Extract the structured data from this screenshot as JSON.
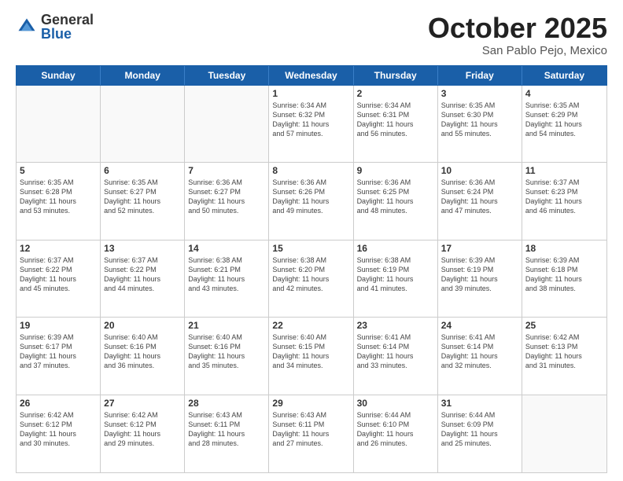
{
  "header": {
    "logo_general": "General",
    "logo_blue": "Blue",
    "month_title": "October 2025",
    "location": "San Pablo Pejo, Mexico"
  },
  "weekdays": [
    "Sunday",
    "Monday",
    "Tuesday",
    "Wednesday",
    "Thursday",
    "Friday",
    "Saturday"
  ],
  "weeks": [
    [
      {
        "day": "",
        "info": ""
      },
      {
        "day": "",
        "info": ""
      },
      {
        "day": "",
        "info": ""
      },
      {
        "day": "1",
        "info": "Sunrise: 6:34 AM\nSunset: 6:32 PM\nDaylight: 11 hours\nand 57 minutes."
      },
      {
        "day": "2",
        "info": "Sunrise: 6:34 AM\nSunset: 6:31 PM\nDaylight: 11 hours\nand 56 minutes."
      },
      {
        "day": "3",
        "info": "Sunrise: 6:35 AM\nSunset: 6:30 PM\nDaylight: 11 hours\nand 55 minutes."
      },
      {
        "day": "4",
        "info": "Sunrise: 6:35 AM\nSunset: 6:29 PM\nDaylight: 11 hours\nand 54 minutes."
      }
    ],
    [
      {
        "day": "5",
        "info": "Sunrise: 6:35 AM\nSunset: 6:28 PM\nDaylight: 11 hours\nand 53 minutes."
      },
      {
        "day": "6",
        "info": "Sunrise: 6:35 AM\nSunset: 6:27 PM\nDaylight: 11 hours\nand 52 minutes."
      },
      {
        "day": "7",
        "info": "Sunrise: 6:36 AM\nSunset: 6:27 PM\nDaylight: 11 hours\nand 50 minutes."
      },
      {
        "day": "8",
        "info": "Sunrise: 6:36 AM\nSunset: 6:26 PM\nDaylight: 11 hours\nand 49 minutes."
      },
      {
        "day": "9",
        "info": "Sunrise: 6:36 AM\nSunset: 6:25 PM\nDaylight: 11 hours\nand 48 minutes."
      },
      {
        "day": "10",
        "info": "Sunrise: 6:36 AM\nSunset: 6:24 PM\nDaylight: 11 hours\nand 47 minutes."
      },
      {
        "day": "11",
        "info": "Sunrise: 6:37 AM\nSunset: 6:23 PM\nDaylight: 11 hours\nand 46 minutes."
      }
    ],
    [
      {
        "day": "12",
        "info": "Sunrise: 6:37 AM\nSunset: 6:22 PM\nDaylight: 11 hours\nand 45 minutes."
      },
      {
        "day": "13",
        "info": "Sunrise: 6:37 AM\nSunset: 6:22 PM\nDaylight: 11 hours\nand 44 minutes."
      },
      {
        "day": "14",
        "info": "Sunrise: 6:38 AM\nSunset: 6:21 PM\nDaylight: 11 hours\nand 43 minutes."
      },
      {
        "day": "15",
        "info": "Sunrise: 6:38 AM\nSunset: 6:20 PM\nDaylight: 11 hours\nand 42 minutes."
      },
      {
        "day": "16",
        "info": "Sunrise: 6:38 AM\nSunset: 6:19 PM\nDaylight: 11 hours\nand 41 minutes."
      },
      {
        "day": "17",
        "info": "Sunrise: 6:39 AM\nSunset: 6:19 PM\nDaylight: 11 hours\nand 39 minutes."
      },
      {
        "day": "18",
        "info": "Sunrise: 6:39 AM\nSunset: 6:18 PM\nDaylight: 11 hours\nand 38 minutes."
      }
    ],
    [
      {
        "day": "19",
        "info": "Sunrise: 6:39 AM\nSunset: 6:17 PM\nDaylight: 11 hours\nand 37 minutes."
      },
      {
        "day": "20",
        "info": "Sunrise: 6:40 AM\nSunset: 6:16 PM\nDaylight: 11 hours\nand 36 minutes."
      },
      {
        "day": "21",
        "info": "Sunrise: 6:40 AM\nSunset: 6:16 PM\nDaylight: 11 hours\nand 35 minutes."
      },
      {
        "day": "22",
        "info": "Sunrise: 6:40 AM\nSunset: 6:15 PM\nDaylight: 11 hours\nand 34 minutes."
      },
      {
        "day": "23",
        "info": "Sunrise: 6:41 AM\nSunset: 6:14 PM\nDaylight: 11 hours\nand 33 minutes."
      },
      {
        "day": "24",
        "info": "Sunrise: 6:41 AM\nSunset: 6:14 PM\nDaylight: 11 hours\nand 32 minutes."
      },
      {
        "day": "25",
        "info": "Sunrise: 6:42 AM\nSunset: 6:13 PM\nDaylight: 11 hours\nand 31 minutes."
      }
    ],
    [
      {
        "day": "26",
        "info": "Sunrise: 6:42 AM\nSunset: 6:12 PM\nDaylight: 11 hours\nand 30 minutes."
      },
      {
        "day": "27",
        "info": "Sunrise: 6:42 AM\nSunset: 6:12 PM\nDaylight: 11 hours\nand 29 minutes."
      },
      {
        "day": "28",
        "info": "Sunrise: 6:43 AM\nSunset: 6:11 PM\nDaylight: 11 hours\nand 28 minutes."
      },
      {
        "day": "29",
        "info": "Sunrise: 6:43 AM\nSunset: 6:11 PM\nDaylight: 11 hours\nand 27 minutes."
      },
      {
        "day": "30",
        "info": "Sunrise: 6:44 AM\nSunset: 6:10 PM\nDaylight: 11 hours\nand 26 minutes."
      },
      {
        "day": "31",
        "info": "Sunrise: 6:44 AM\nSunset: 6:09 PM\nDaylight: 11 hours\nand 25 minutes."
      },
      {
        "day": "",
        "info": ""
      }
    ]
  ]
}
